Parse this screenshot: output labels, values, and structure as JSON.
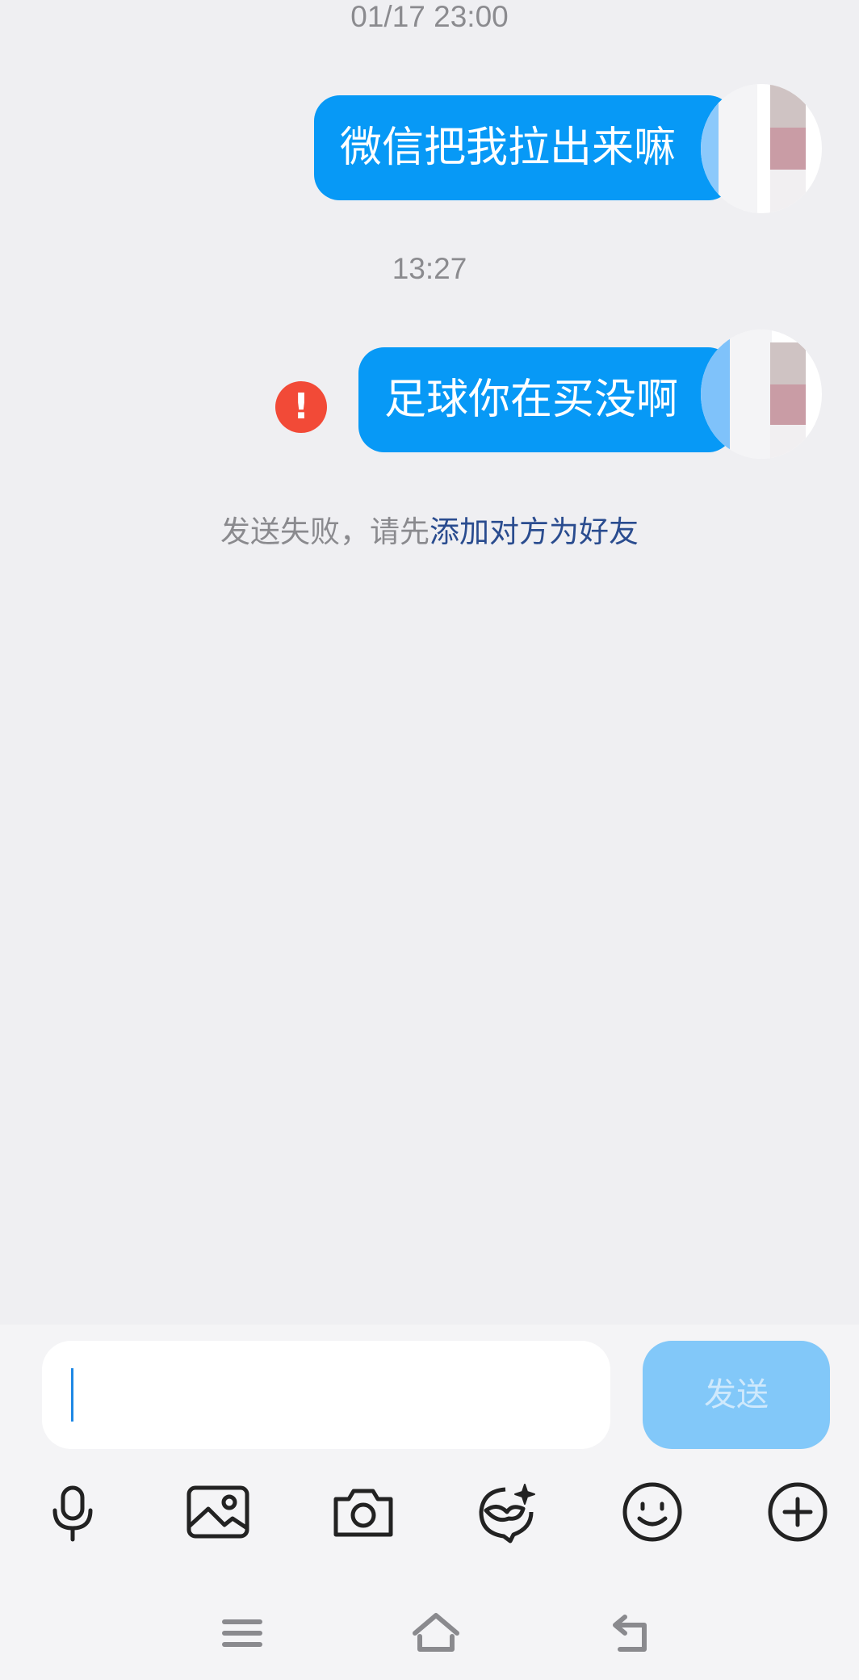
{
  "messages": [
    {
      "timestamp": "01/17 23:00",
      "text": "微信把我拉出来嘛"
    },
    {
      "timestamp": "13:27",
      "text": "足球你在买没啊"
    }
  ],
  "notice": {
    "prefix": "发送失败，请先",
    "link": "添加对方为好友"
  },
  "input": {
    "value": "",
    "send_label": "发送"
  },
  "toolbar": {
    "icons": [
      "microphone-icon",
      "image-icon",
      "camera-icon",
      "sticker-icon",
      "emoji-icon",
      "plus-icon"
    ]
  },
  "navigation": {
    "icons": [
      "menu-icon",
      "home-icon",
      "back-icon"
    ]
  },
  "colors": {
    "bubble": "#0799f6",
    "error": "#f24a37",
    "link": "#2a4c8f",
    "send_disabled": "#82c8f9"
  }
}
